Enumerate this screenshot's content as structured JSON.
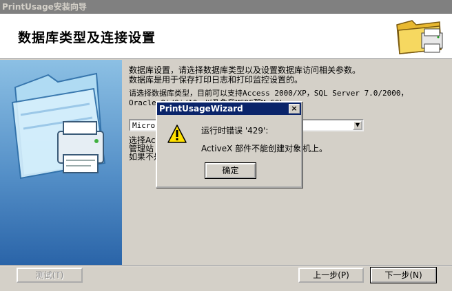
{
  "window": {
    "title": "PrintUsage安装向导"
  },
  "header": {
    "title": "数据库类型及连接设置",
    "icon": "folder-printer-icon"
  },
  "content": {
    "intro_line1": "数据库设置，请选择数据库类型以及设置数据库访问相关参数。",
    "intro_line2": "数据库是用于保存打印日志和打印监控设置的。",
    "select_line1": "请选择数据库类型，目前可以支持Access 2000/XP，SQL Server 7.0/2000，",
    "select_line2_part": "Oracle 8i/9i/10",
    "select_line2_tail": "，以及象我MSDE那M SQL",
    "combo_value": "Micros",
    "note_line1_start": "选择Acc",
    "note_line2_start": "管理站",
    "note_line2_end": "机上。",
    "note_line3_start": "如果不是"
  },
  "dialog": {
    "title": "PrintUsageWizard",
    "close_label": "×",
    "icon": "warning-icon",
    "error_line": "运行时错误 '429':",
    "message": "ActiveX 部件不能创建对象",
    "ok_label": "确定"
  },
  "buttons": {
    "test": "测试(T)",
    "back": "上一步(P)",
    "next": "下一步(N)"
  }
}
